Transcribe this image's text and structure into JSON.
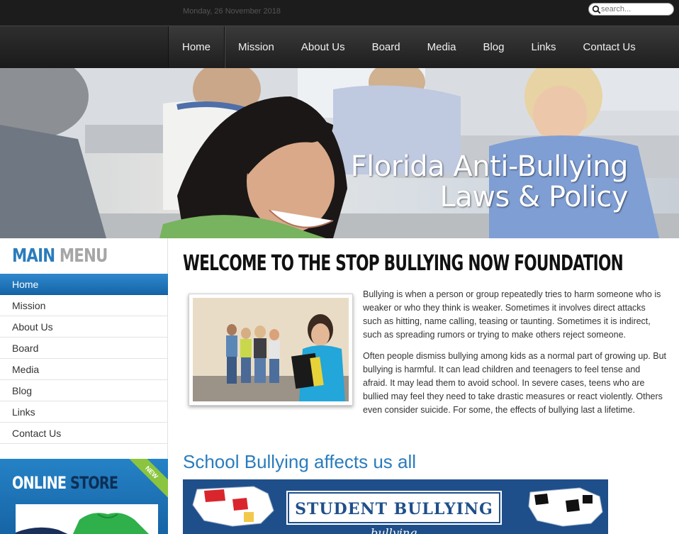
{
  "topbar": {
    "date": "Monday, 26 November 2018",
    "search_placeholder": "search..."
  },
  "nav": {
    "items": [
      "Home",
      "Mission",
      "About Us",
      "Board",
      "Media",
      "Blog",
      "Links",
      "Contact Us"
    ],
    "active": "Home"
  },
  "hero": {
    "title_line1": "Florida Anti-Bullying",
    "title_line2": "Laws & Policy"
  },
  "sidebar": {
    "heading_primary": "MAIN",
    "heading_secondary": "MENU",
    "items": [
      "Home",
      "Mission",
      "About Us",
      "Board",
      "Media",
      "Blog",
      "Links",
      "Contact Us"
    ],
    "active": "Home",
    "store": {
      "title_primary": "ONLINE",
      "title_secondary": "STORE",
      "ribbon": "NEW"
    }
  },
  "main": {
    "title": "WELCOME TO THE STOP BULLYING NOW FOUNDATION",
    "paragraphs": [
      "Bullying is when a person or group repeatedly tries to harm someone who is weaker or who they think is weaker. Sometimes it involves direct attacks such as hitting, name calling, teasing or taunting. Sometimes it is indirect, such as spreading rumors or trying to make others reject someone.",
      "Often people dismiss bullying among kids as a normal part of growing up. But bullying is harmful. It can lead children and teenagers to feel tense and afraid. It may lead them to avoid school. In severe cases, teens who are bullied may feel they need to take drastic measures or react violently. Others even consider suicide. For some, the effects of bullying last a lifetime."
    ],
    "subheading": "School Bullying affects us all",
    "banner_title": "STUDENT BULLYING",
    "banner_sub": "bullying"
  },
  "colors": {
    "accent_blue": "#2a7cbd",
    "nav_dark": "#1e1e1e",
    "store_green": "#8bc53f"
  }
}
